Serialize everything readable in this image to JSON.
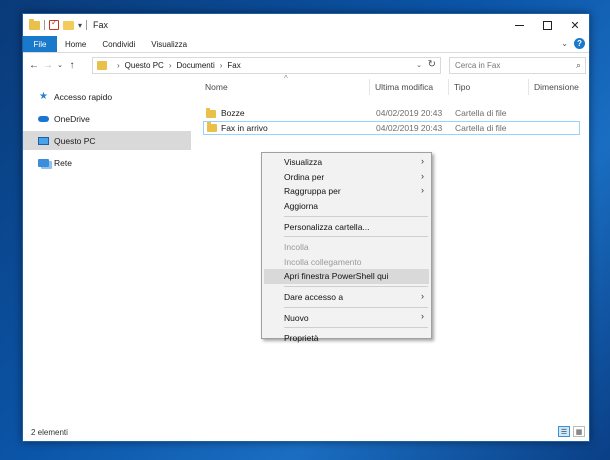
{
  "window": {
    "title": "Fax",
    "controls": {
      "minimize": "minimize",
      "maximize": "maximize",
      "close": "✕"
    }
  },
  "ribbon": {
    "tabs": [
      "File",
      "Home",
      "Condividi",
      "Visualizza"
    ]
  },
  "address": {
    "breadcrumbs": [
      "Questo PC",
      "Documenti",
      "Fax"
    ],
    "search_placeholder": "Cerca in Fax"
  },
  "navpane": {
    "items": [
      {
        "label": "Accesso rapido",
        "icon": "star-icon"
      },
      {
        "label": "OneDrive",
        "icon": "cloud-icon"
      },
      {
        "label": "Questo PC",
        "icon": "computer-icon",
        "active": true
      },
      {
        "label": "Rete",
        "icon": "network-icon"
      }
    ]
  },
  "filelist": {
    "columns": [
      "Nome",
      "Ultima modifica",
      "Tipo",
      "Dimensione"
    ],
    "rows": [
      {
        "name": "Bozze",
        "modified": "04/02/2019 20:43",
        "type": "Cartella di file"
      },
      {
        "name": "Fax in arrivo",
        "modified": "04/02/2019 20:43",
        "type": "Cartella di file",
        "selected": true
      }
    ]
  },
  "status": {
    "count_text": "2 elementi"
  },
  "context_menu": {
    "items": [
      "Visualizza",
      "Ordina per",
      "Raggruppa per",
      "Aggiorna",
      "Personalizza cartella...",
      "Incolla",
      "Incolla collegamento",
      "Apri finestra PowerShell qui",
      "Dare accesso a",
      "Nuovo",
      "Proprietà"
    ]
  }
}
